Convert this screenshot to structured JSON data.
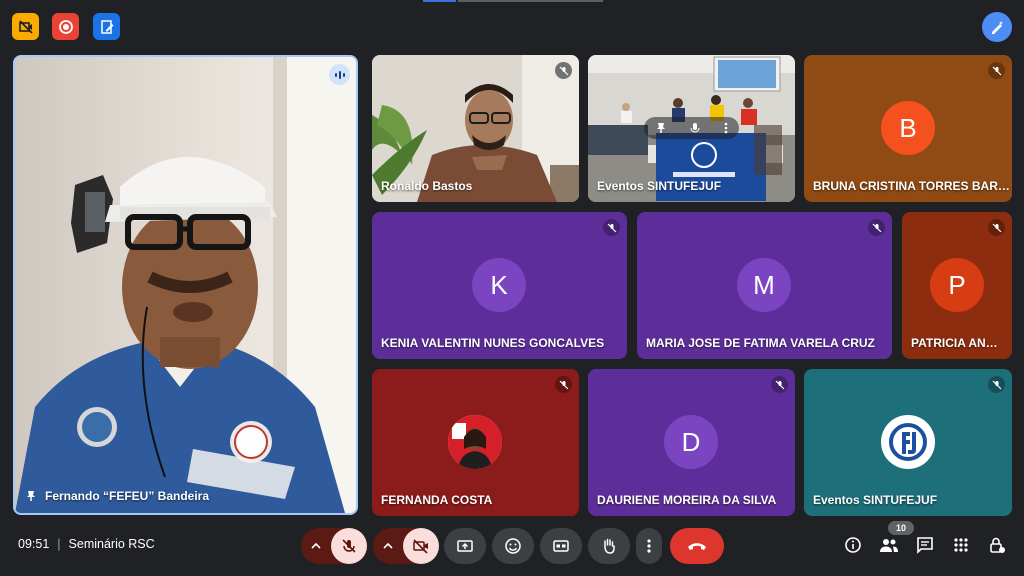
{
  "top": {
    "icons": [
      "no-video-square-icon",
      "record-icon",
      "edit-note-icon",
      "magic-pen-icon"
    ],
    "colors": {
      "yellow": "#f9ab00",
      "red": "#ea4335",
      "blue": "#1a73e8",
      "accent": "#8ab4f8"
    }
  },
  "main_speaker": {
    "name": "Fernando “FEFEU” Bandeira",
    "active": true
  },
  "tiles": [
    {
      "name": "Ronaldo Bastos",
      "type": "video"
    },
    {
      "name": "Eventos SINTUFEJUF",
      "type": "video"
    },
    {
      "name": "BRUNA CRISTINA TORRES BAR…",
      "initial": "B",
      "avatar_color": "#f4511e",
      "bg": "#8f4b13"
    },
    {
      "name": "KENIA VALENTIN NUNES GONCALVES",
      "initial": "K",
      "avatar_color": "#7b45c2",
      "bg": "#5d2e9a"
    },
    {
      "name": "MARIA JOSE DE FATIMA VARELA CRUZ",
      "initial": "M",
      "avatar_color": "#7b45c2",
      "bg": "#5d2e9a"
    },
    {
      "name": "PATRICIA AN…",
      "initial": "P",
      "avatar_color": "#d73d12",
      "bg": "#8d2d0f"
    },
    {
      "name": "FERNANDA COSTA",
      "type": "photo",
      "bg": "#8c1b1b"
    },
    {
      "name": "DAURIENE MOREIRA DA SILVA",
      "initial": "D",
      "avatar_color": "#7b45c2",
      "bg": "#5d2e9a"
    },
    {
      "name": "Eventos SINTUFEJUF",
      "type": "logo",
      "bg": "#1d6f7a"
    }
  ],
  "bottom": {
    "time": "09:51",
    "separator": "|",
    "meeting_title": "Seminário RSC",
    "participant_count": "10"
  }
}
